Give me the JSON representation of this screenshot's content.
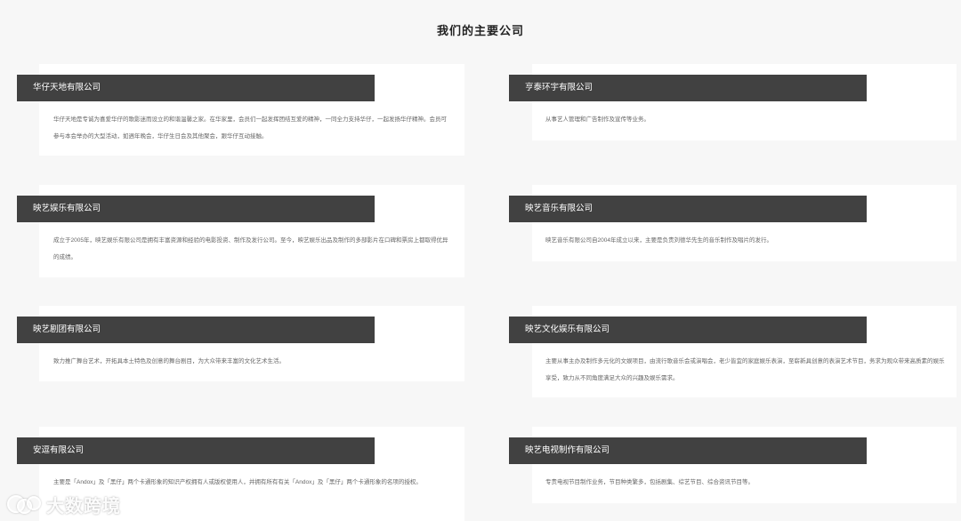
{
  "page": {
    "title": "我们的主要公司"
  },
  "companies": [
    {
      "name": "华仔天地有限公司",
      "desc": "华仔天地是专诚为喜爱华仔的歌影迷而设立的和谐温馨之家。在华家里，会员们一起发挥团结互爱的精神，一同全力支持华仔，一起发扬华仔精神。会员可参与本会举办的大型活动，如週年晚会，华仔生日会及其他聚会，跟华仔互动接触。"
    },
    {
      "name": "亨泰环宇有限公司",
      "desc": "从事艺人管理和广告制作及宣传等业务。"
    },
    {
      "name": "映艺娱乐有限公司",
      "desc": "成立于2005年，映艺娱乐有限公司是拥有丰富资源和经验的电影投资、制作及发行公司。至今，映艺娱乐出品及制作的多部影片在口碑和票房上都取得优异的成绩。"
    },
    {
      "name": "映艺音乐有限公司",
      "desc": "映艺音乐有限公司自2004年成立以来，主要是负责刘德华先生的音乐制作及唱片的发行。"
    },
    {
      "name": "映艺剧团有限公司",
      "desc": "致力推广舞台艺术，开拓具本土特色及创意的舞台剧目，为大众带来丰富的文化艺术生活。"
    },
    {
      "name": "映艺文化娱乐有限公司",
      "desc": "主要从事主办及制作多元化的文娱项目，由流行歌音乐会或演唱会，老少皆宜的家庭娱乐表演，至崭新具创意的表演艺术节目，务求为观众带来高质素的娱乐享受，致力从不同角度满足大众的兴趣及娱乐需求。"
    },
    {
      "name": "安逗有限公司",
      "desc": "主要是「Andox」及「黑仔」两个卡通形象的知识产权拥有人或版权使用人，并拥有所有有关「Andox」及「黑仔」两个卡通形象的名项的授权。"
    },
    {
      "name": "映艺电视制作有限公司",
      "desc": "专责电视节目制作业务，节目种类繁多，包括剧集、综艺节目、综合资讯节目等。"
    }
  ],
  "watermark": {
    "text": "大数跨境",
    "icon": "interlocking-rings-logo"
  }
}
